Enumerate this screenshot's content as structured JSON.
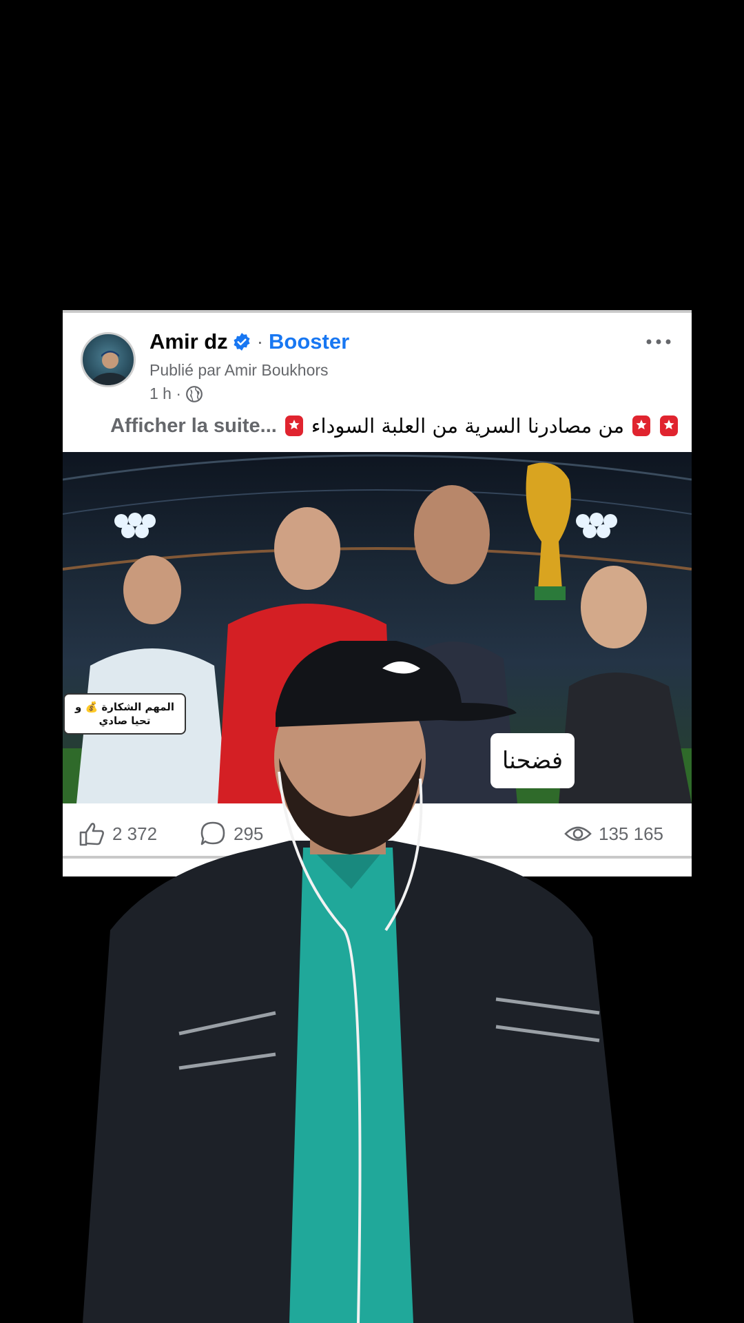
{
  "post": {
    "author": "Amir dz",
    "separator": "·",
    "tag": "Booster",
    "published_by": "Publié par Amir Boukhors",
    "time": "1 h ·",
    "text_arabic": "من مصادرنا السرية من العلبة السوداء",
    "see_more": "Afficher la suite...",
    "icons": {
      "verified": "verified-badge-icon",
      "globe": "globe-icon",
      "more": "more-dots-icon",
      "siren": "siren-emoji-icon"
    }
  },
  "image": {
    "bubble_left": "المهم الشكارة 💰 و تحيا صادي",
    "bubble_right": "فضحنا"
  },
  "stats": {
    "likes": "2 372",
    "comments": "295",
    "views": "135 165"
  },
  "colors": {
    "brand_blue": "#1877f2",
    "text_gray": "#65676b",
    "background": "#000000"
  }
}
